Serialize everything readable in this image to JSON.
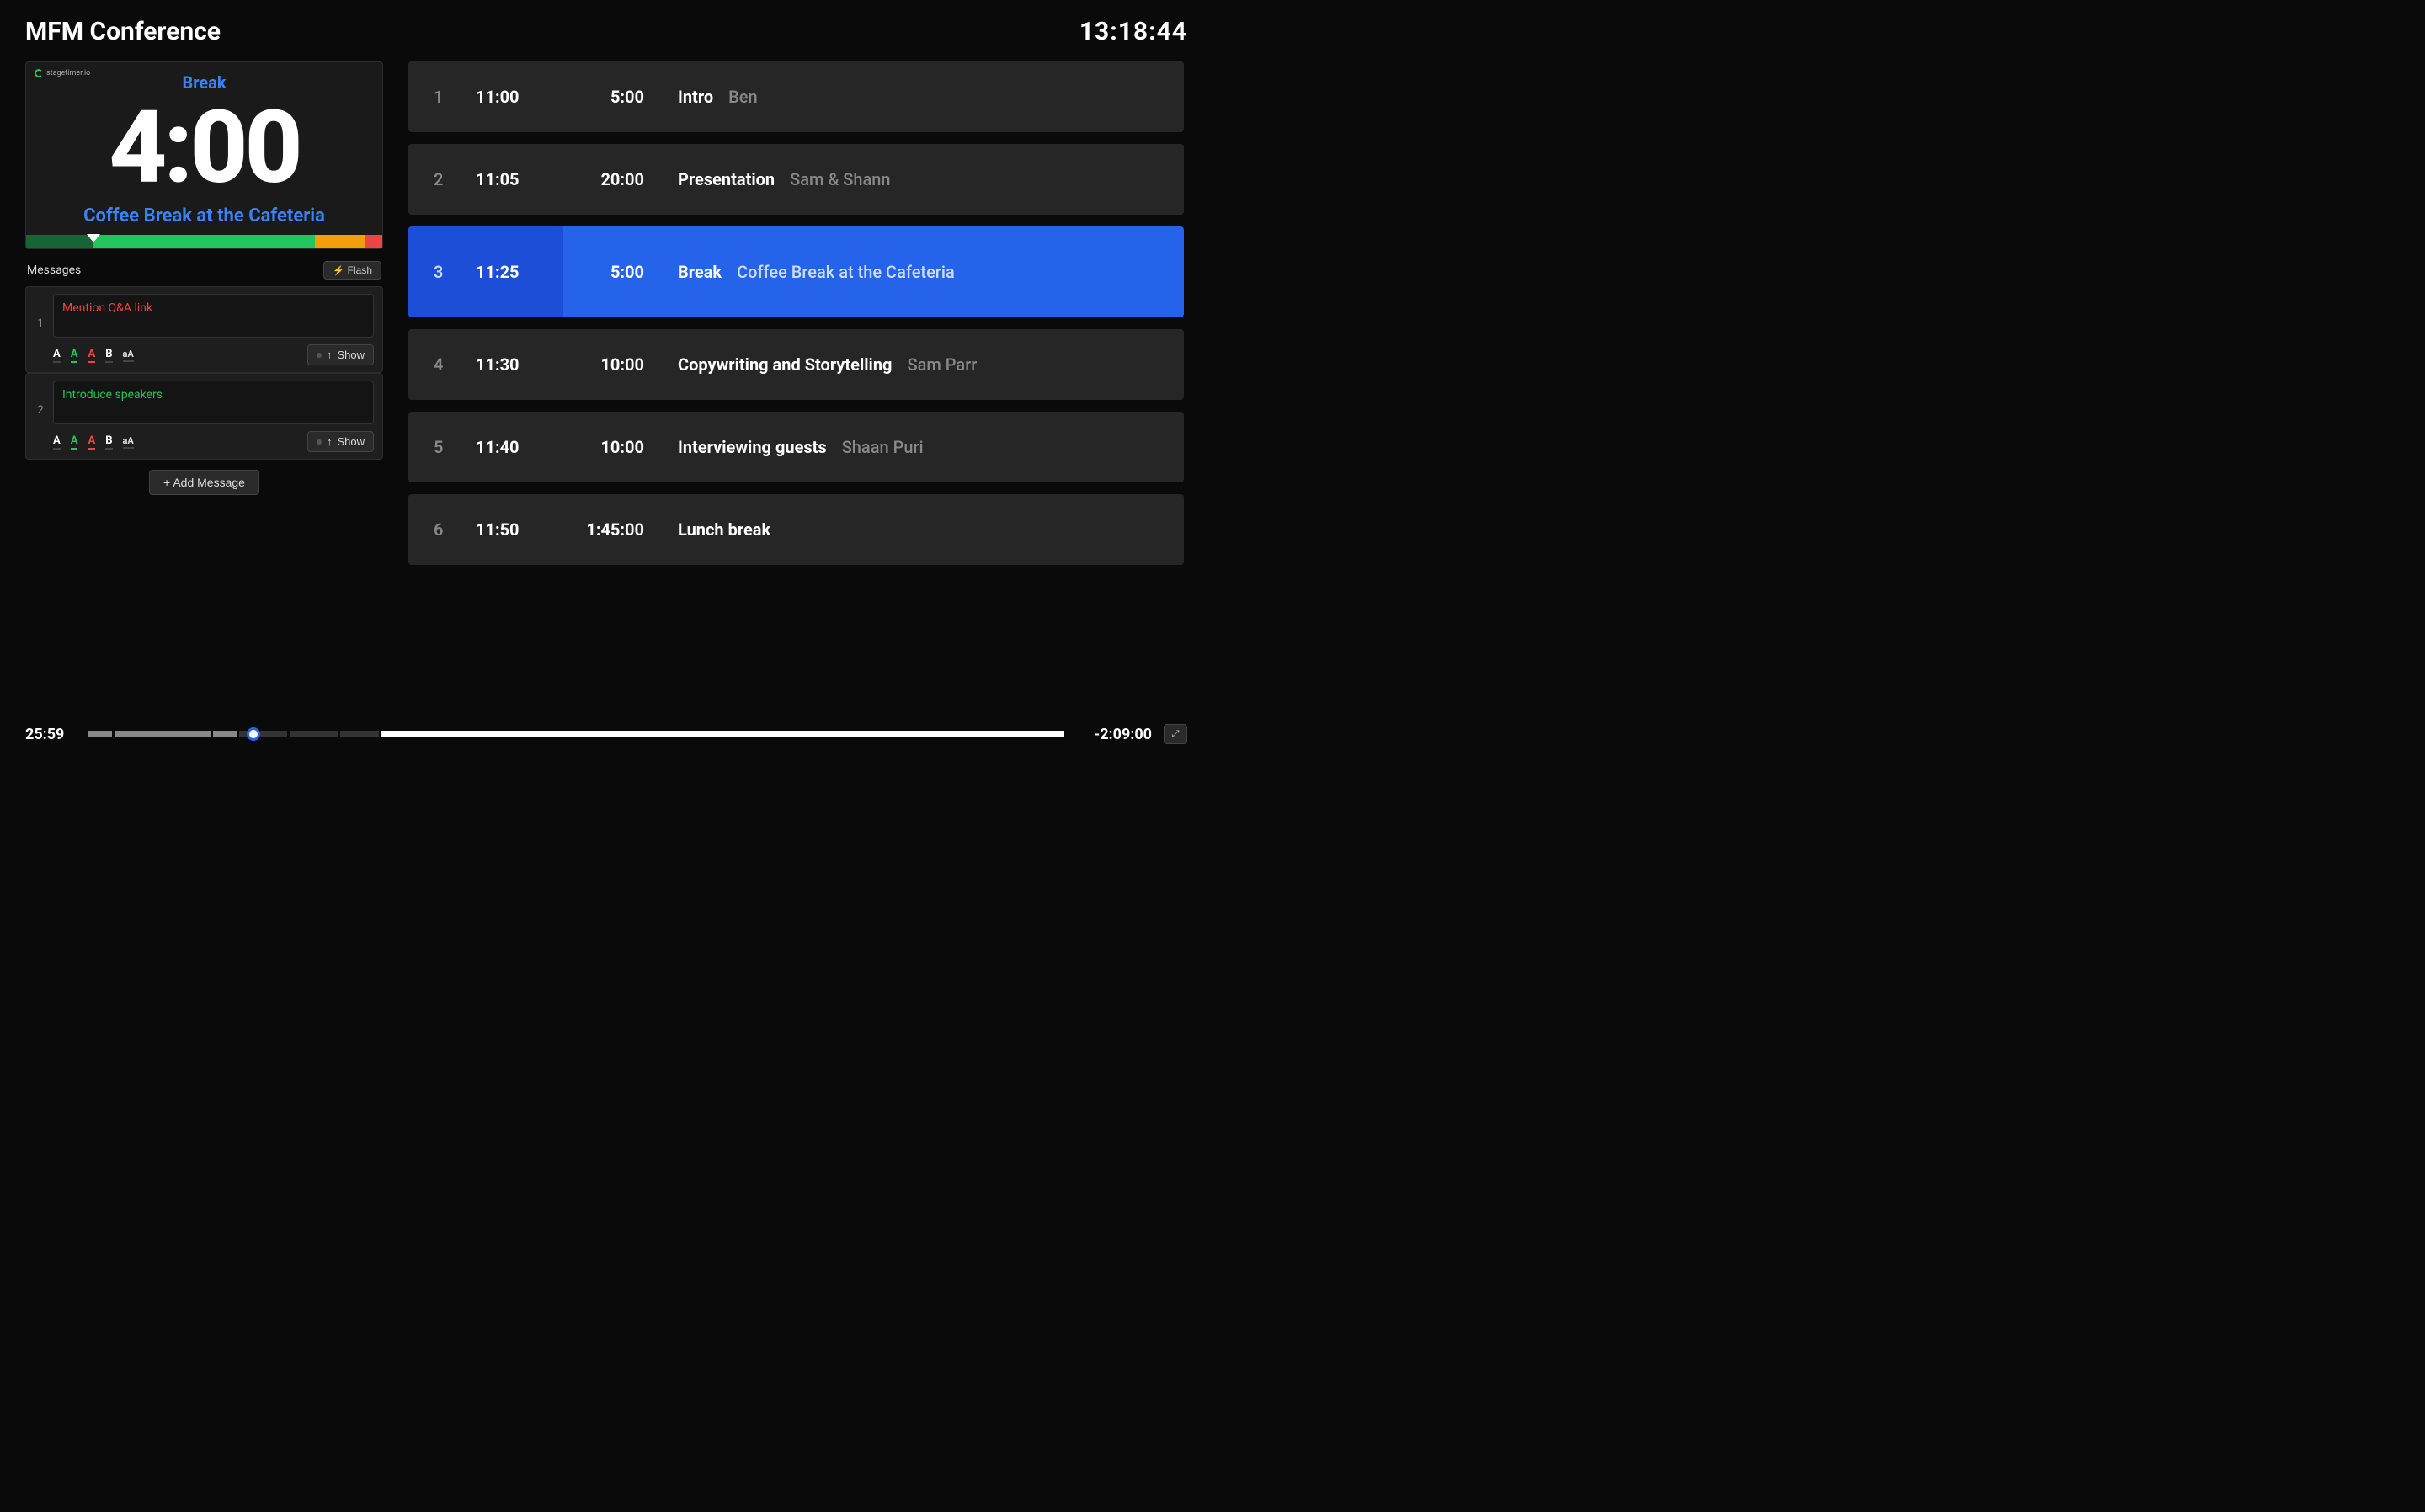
{
  "header": {
    "title": "MFM Conference",
    "clock": "13:18:44"
  },
  "preview": {
    "brand": "stagetimer.io",
    "label": "Break",
    "time": "4:00",
    "subtitle": "Coffee Break at the Cafeteria",
    "progress": {
      "dark_pct": 19,
      "green_pct": 62,
      "orange_pct": 14,
      "red_pct": 5,
      "marker_pct": 19
    }
  },
  "messages": {
    "title": "Messages",
    "flash_label": "Flash",
    "show_label": "Show",
    "add_label": "+ Add Message",
    "items": [
      {
        "num": "1",
        "text": "Mention Q&A link",
        "color": "red"
      },
      {
        "num": "2",
        "text": "Introduce speakers",
        "color": "green"
      }
    ]
  },
  "agenda": [
    {
      "num": "1",
      "start": "11:00",
      "dur": "5:00",
      "title": "Intro",
      "speaker": "Ben",
      "active": false
    },
    {
      "num": "2",
      "start": "11:05",
      "dur": "20:00",
      "title": "Presentation",
      "speaker": "Sam & Shann",
      "active": false
    },
    {
      "num": "3",
      "start": "11:25",
      "dur": "5:00",
      "title": "Break",
      "speaker": "Coffee Break at the Cafeteria",
      "active": true
    },
    {
      "num": "4",
      "start": "11:30",
      "dur": "10:00",
      "title": "Copywriting and Storytelling",
      "speaker": "Sam Parr",
      "active": false
    },
    {
      "num": "5",
      "start": "11:40",
      "dur": "10:00",
      "title": "Interviewing guests",
      "speaker": "Shaan Puri",
      "active": false
    },
    {
      "num": "6",
      "start": "11:50",
      "dur": "1:45:00",
      "title": "Lunch break",
      "speaker": "",
      "active": false
    }
  ],
  "footer": {
    "elapsed": "25:59",
    "remaining": "-2:09:00",
    "thumb_pct": 17,
    "segments": [
      {
        "w": 2.5,
        "cls": "done"
      },
      {
        "w": 10,
        "cls": "done"
      },
      {
        "w": 2.5,
        "cls": "done"
      },
      {
        "w": 5,
        "cls": ""
      },
      {
        "w": 5,
        "cls": ""
      },
      {
        "w": 4,
        "cls": ""
      },
      {
        "w": 71,
        "cls": "big"
      }
    ]
  }
}
